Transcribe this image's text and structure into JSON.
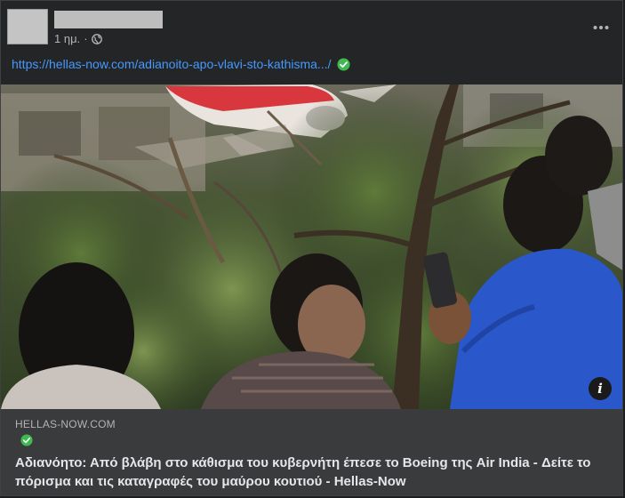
{
  "post": {
    "timestamp": "1 ημ.",
    "separator": "·",
    "privacy_icon": "globe-icon",
    "more_icon": "more-horizontal-icon",
    "link_text": "https://hellas-now.com/adianoito-apo-vlavi-sto-kathisma.../",
    "link_verified_icon": "verified-check-icon"
  },
  "preview": {
    "domain": "HELLAS-NOW.COM",
    "verified_icon": "verified-check-icon",
    "title": "Αδιανόητο: Από βλάβη στο κάθισμα του κυβερνήτη έπεσε το Boeing της Air India - Δείτε το πόρισμα και τις καταγραφές του μαύρου κουτιού - Hellas-Now",
    "info_label": "i"
  },
  "colors": {
    "background": "#242526",
    "link": "#4599ff",
    "verified": "#3fb950",
    "preview_bg": "#3a3b3c",
    "text_primary": "#e4e6eb",
    "text_secondary": "#b0b3b8"
  }
}
